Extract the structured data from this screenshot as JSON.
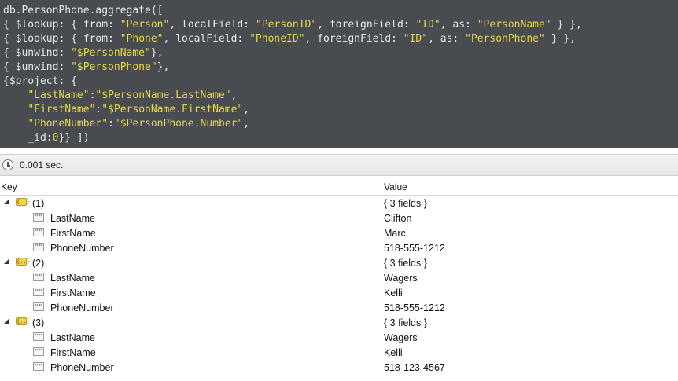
{
  "query": {
    "lines": [
      [
        {
          "t": "db.PersonPhone.aggregate([",
          "c": "kw"
        }
      ],
      [
        {
          "t": "{ $lookup: { from: ",
          "c": "kw"
        },
        {
          "t": "\"Person\"",
          "c": "str"
        },
        {
          "t": ", localField: ",
          "c": "kw"
        },
        {
          "t": "\"PersonID\"",
          "c": "str"
        },
        {
          "t": ", foreignField: ",
          "c": "kw"
        },
        {
          "t": "\"ID\"",
          "c": "str"
        },
        {
          "t": ", as: ",
          "c": "kw"
        },
        {
          "t": "\"PersonName\"",
          "c": "str"
        },
        {
          "t": " } },",
          "c": "kw"
        }
      ],
      [
        {
          "t": "{ $lookup: { from: ",
          "c": "kw"
        },
        {
          "t": "\"Phone\"",
          "c": "str"
        },
        {
          "t": ", localField: ",
          "c": "kw"
        },
        {
          "t": "\"PhoneID\"",
          "c": "str"
        },
        {
          "t": ", foreignField: ",
          "c": "kw"
        },
        {
          "t": "\"ID\"",
          "c": "str"
        },
        {
          "t": ", as: ",
          "c": "kw"
        },
        {
          "t": "\"PersonPhone\"",
          "c": "str"
        },
        {
          "t": " } },",
          "c": "kw"
        }
      ],
      [
        {
          "t": "{ $unwind: ",
          "c": "kw"
        },
        {
          "t": "\"$PersonName\"",
          "c": "str"
        },
        {
          "t": "},",
          "c": "kw"
        }
      ],
      [
        {
          "t": "{ $unwind: ",
          "c": "kw"
        },
        {
          "t": "\"$PersonPhone\"",
          "c": "str"
        },
        {
          "t": "},",
          "c": "kw"
        }
      ],
      [
        {
          "t": "{$project: {",
          "c": "kw"
        }
      ],
      [
        {
          "t": "    ",
          "c": "kw"
        },
        {
          "t": "\"LastName\"",
          "c": "str"
        },
        {
          "t": ":",
          "c": "kw"
        },
        {
          "t": "\"$PersonName.LastName\"",
          "c": "str"
        },
        {
          "t": ",",
          "c": "kw"
        }
      ],
      [
        {
          "t": "    ",
          "c": "kw"
        },
        {
          "t": "\"FirstName\"",
          "c": "str"
        },
        {
          "t": ":",
          "c": "kw"
        },
        {
          "t": "\"$PersonName.FirstName\"",
          "c": "str"
        },
        {
          "t": ",",
          "c": "kw"
        }
      ],
      [
        {
          "t": "    ",
          "c": "kw"
        },
        {
          "t": "\"PhoneNumber\"",
          "c": "str"
        },
        {
          "t": ":",
          "c": "kw"
        },
        {
          "t": "\"$PersonPhone.Number\"",
          "c": "str"
        },
        {
          "t": ",",
          "c": "kw"
        }
      ],
      [
        {
          "t": "    _id:",
          "c": "kw"
        },
        {
          "t": "0",
          "c": "num"
        },
        {
          "t": "}} ])",
          "c": "kw"
        }
      ]
    ]
  },
  "status": {
    "time": "0.001 sec.",
    "icon": "clock-icon"
  },
  "grid": {
    "col_key": "Key",
    "col_value": "Value",
    "rows": [
      {
        "kind": "object",
        "label": "(1)",
        "value": "{ 3 fields }"
      },
      {
        "kind": "string",
        "label": "LastName",
        "value": "Clifton"
      },
      {
        "kind": "string",
        "label": "FirstName",
        "value": "Marc"
      },
      {
        "kind": "string",
        "label": "PhoneNumber",
        "value": "518-555-1212"
      },
      {
        "kind": "object",
        "label": "(2)",
        "value": "{ 3 fields }"
      },
      {
        "kind": "string",
        "label": "LastName",
        "value": "Wagers"
      },
      {
        "kind": "string",
        "label": "FirstName",
        "value": "Kelli"
      },
      {
        "kind": "string",
        "label": "PhoneNumber",
        "value": "518-555-1212"
      },
      {
        "kind": "object",
        "label": "(3)",
        "value": "{ 3 fields }"
      },
      {
        "kind": "string",
        "label": "LastName",
        "value": "Wagers"
      },
      {
        "kind": "string",
        "label": "FirstName",
        "value": "Kelli"
      },
      {
        "kind": "string",
        "label": "PhoneNumber",
        "value": "518-123-4567"
      }
    ]
  },
  "icons": {
    "object": "object-icon",
    "string": "string-icon",
    "expand": "expand-triangle-icon"
  }
}
